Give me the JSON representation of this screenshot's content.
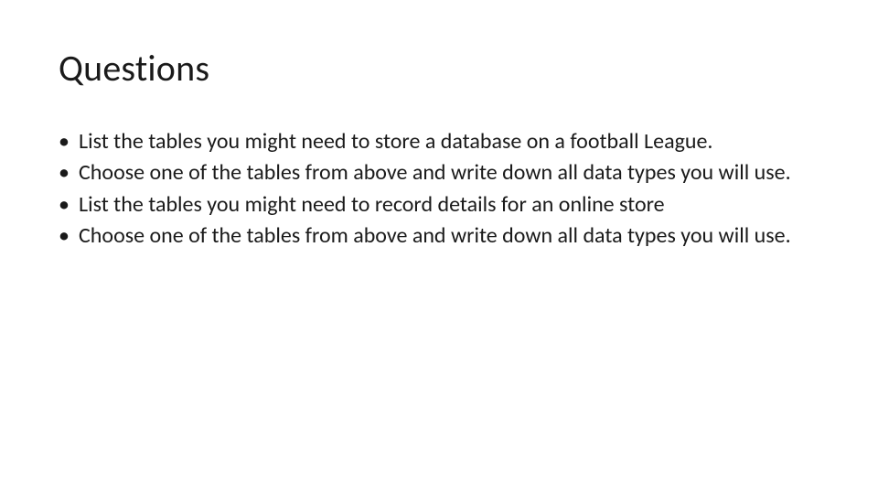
{
  "slide": {
    "title": "Questions",
    "bullets": [
      "List the tables you might need to store a database on a football League.",
      "Choose one of the tables from above and write down all data types you will use.",
      "List the tables you might need to record details for an online store",
      "Choose one of the tables from above and write down all data types you will use."
    ]
  }
}
